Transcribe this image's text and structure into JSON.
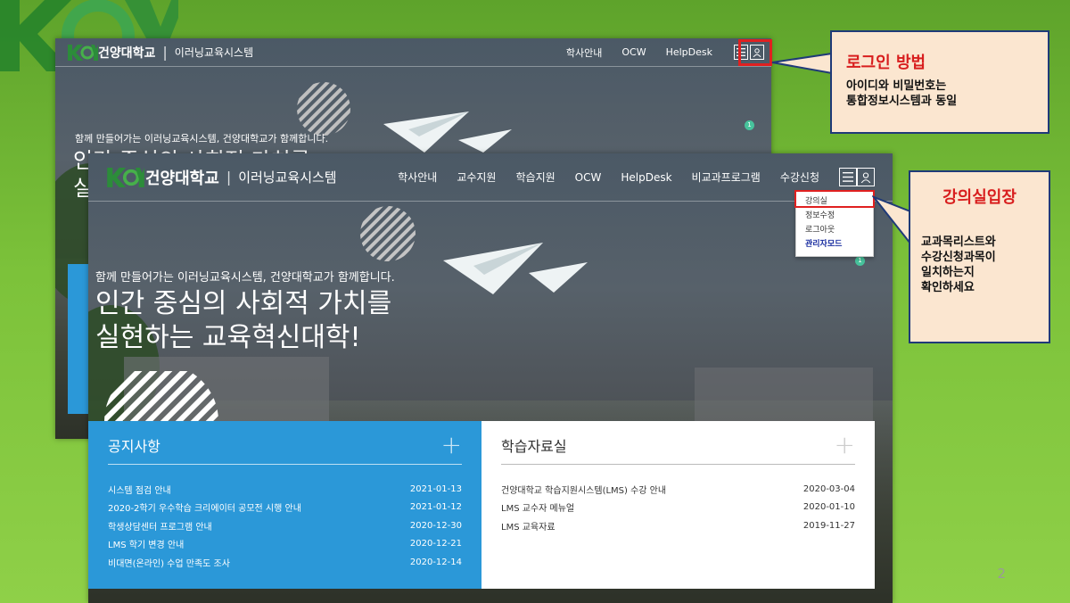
{
  "page_number": "2",
  "back_screenshot": {
    "logo": {
      "name": "건양대학교",
      "subtitle": "이러닝교육시스템"
    },
    "menu": [
      "학사안내",
      "OCW",
      "HelpDesk"
    ],
    "tagline": "함께 만들어가는 이러닝교육시스템, 건양대학교가 함께합니다.",
    "badge": "1"
  },
  "front_screenshot": {
    "logo": {
      "name": "건양대학교",
      "subtitle": "이러닝교육시스템"
    },
    "menu": [
      "학사안내",
      "교수지원",
      "학습지원",
      "OCW",
      "HelpDesk",
      "비교과프로그램",
      "수강신청"
    ],
    "user_dropdown": [
      "강의실",
      "정보수정",
      "로그아웃",
      "관리자모드"
    ],
    "tagline": "함께 만들어가는 이러닝교육시스템, 건양대학교가 함께합니다.",
    "headline": [
      "인간 중심의 사회적 가치를",
      "실현하는 교육혁신대학!"
    ],
    "badge": "1",
    "notice": {
      "title": "공지사항",
      "items": [
        {
          "title": "시스템 점검 안내",
          "date": "2021-01-13"
        },
        {
          "title": "2020-2학기 우수학습 크리에이터 공모전 시행 안내",
          "date": "2021-01-12"
        },
        {
          "title": "학생상담센터 프로그램 안내",
          "date": "2020-12-30"
        },
        {
          "title": "LMS 학기 변경 안내",
          "date": "2020-12-21"
        },
        {
          "title": "비대면(온라인) 수업 만족도 조사",
          "date": "2020-12-14"
        }
      ]
    },
    "library": {
      "title": "학습자료실",
      "items": [
        {
          "title": "건양대학교 학습지원시스템(LMS) 수강 안내",
          "date": "2020-03-04"
        },
        {
          "title": "LMS 교수자 메뉴얼",
          "date": "2020-01-10"
        },
        {
          "title": "LMS 교육자료",
          "date": "2019-11-27"
        }
      ]
    }
  },
  "callouts": {
    "login": {
      "title": "로그인 방법",
      "body": "아이디와 비밀번호는\n통합정보시스템과 동일"
    },
    "classroom": {
      "title": "강의실입장",
      "body": "교과목리스트와\n수강신청과목이\n일치하는지\n확인하세요"
    }
  },
  "colors": {
    "accent_blue": "#2b98d8",
    "highlight_red": "#e02020",
    "callout_bg": "#fbe6d0",
    "callout_border": "#1f3a78",
    "brand_green": "#3aa655"
  }
}
